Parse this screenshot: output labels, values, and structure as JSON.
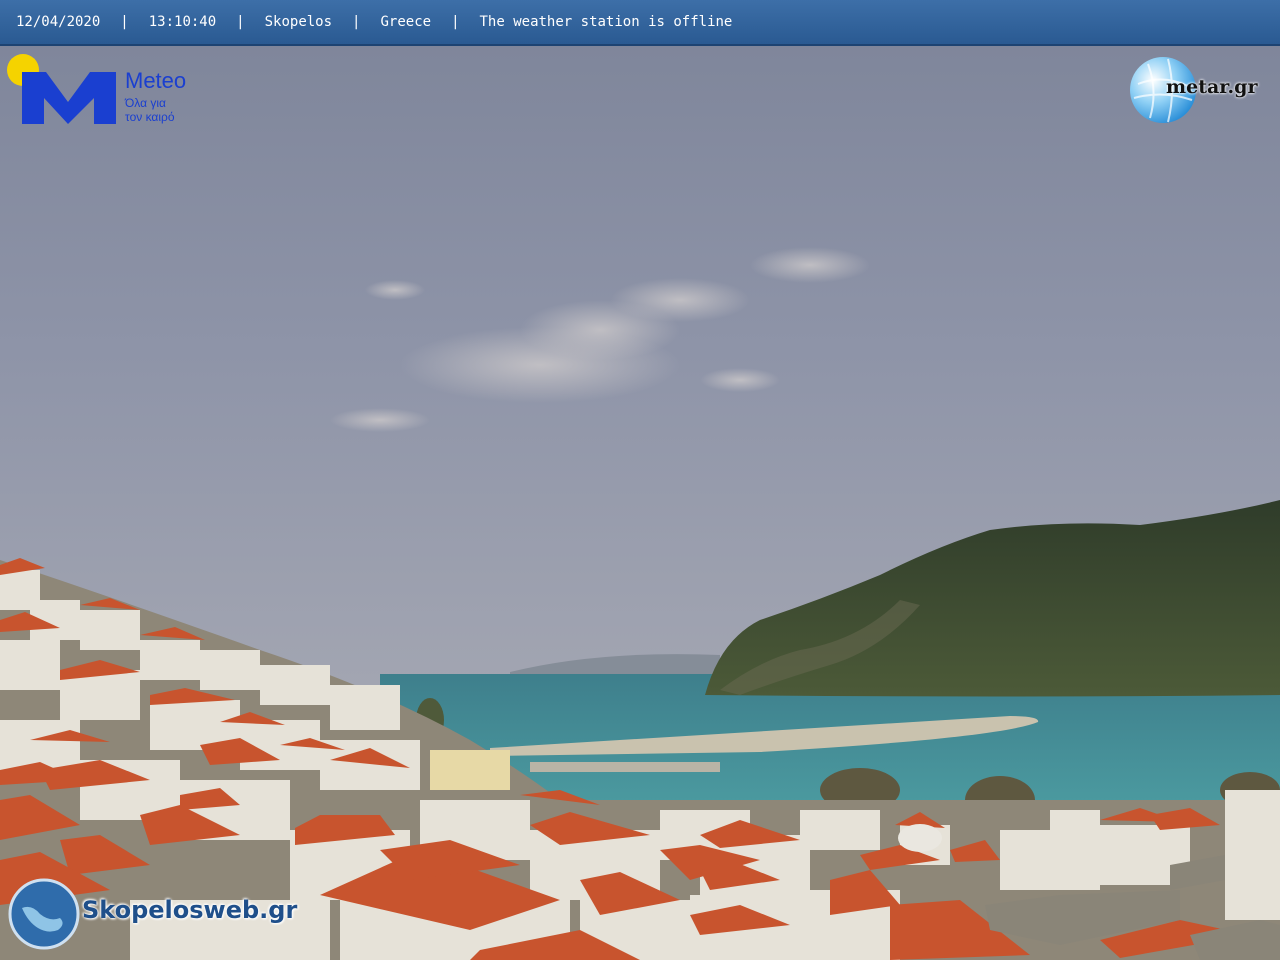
{
  "overlay": {
    "date": "12/04/2020",
    "time": "13:10:40",
    "location": "Skopelos",
    "country": "Greece",
    "status": "The weather station is offline",
    "separator": "|"
  },
  "logos": {
    "meteo_title": "Meteo",
    "meteo_tagline_1": "Όλα για",
    "meteo_tagline_2": "τον καιρό",
    "metar": "metar.gr",
    "skopelosweb": "Skopelosweb.gr"
  },
  "colors": {
    "sky": "#8d93a8",
    "sea": "#3f8e98",
    "roof": "#c8542e",
    "hill": "#3c4a30",
    "banner": "#2f5f98"
  }
}
